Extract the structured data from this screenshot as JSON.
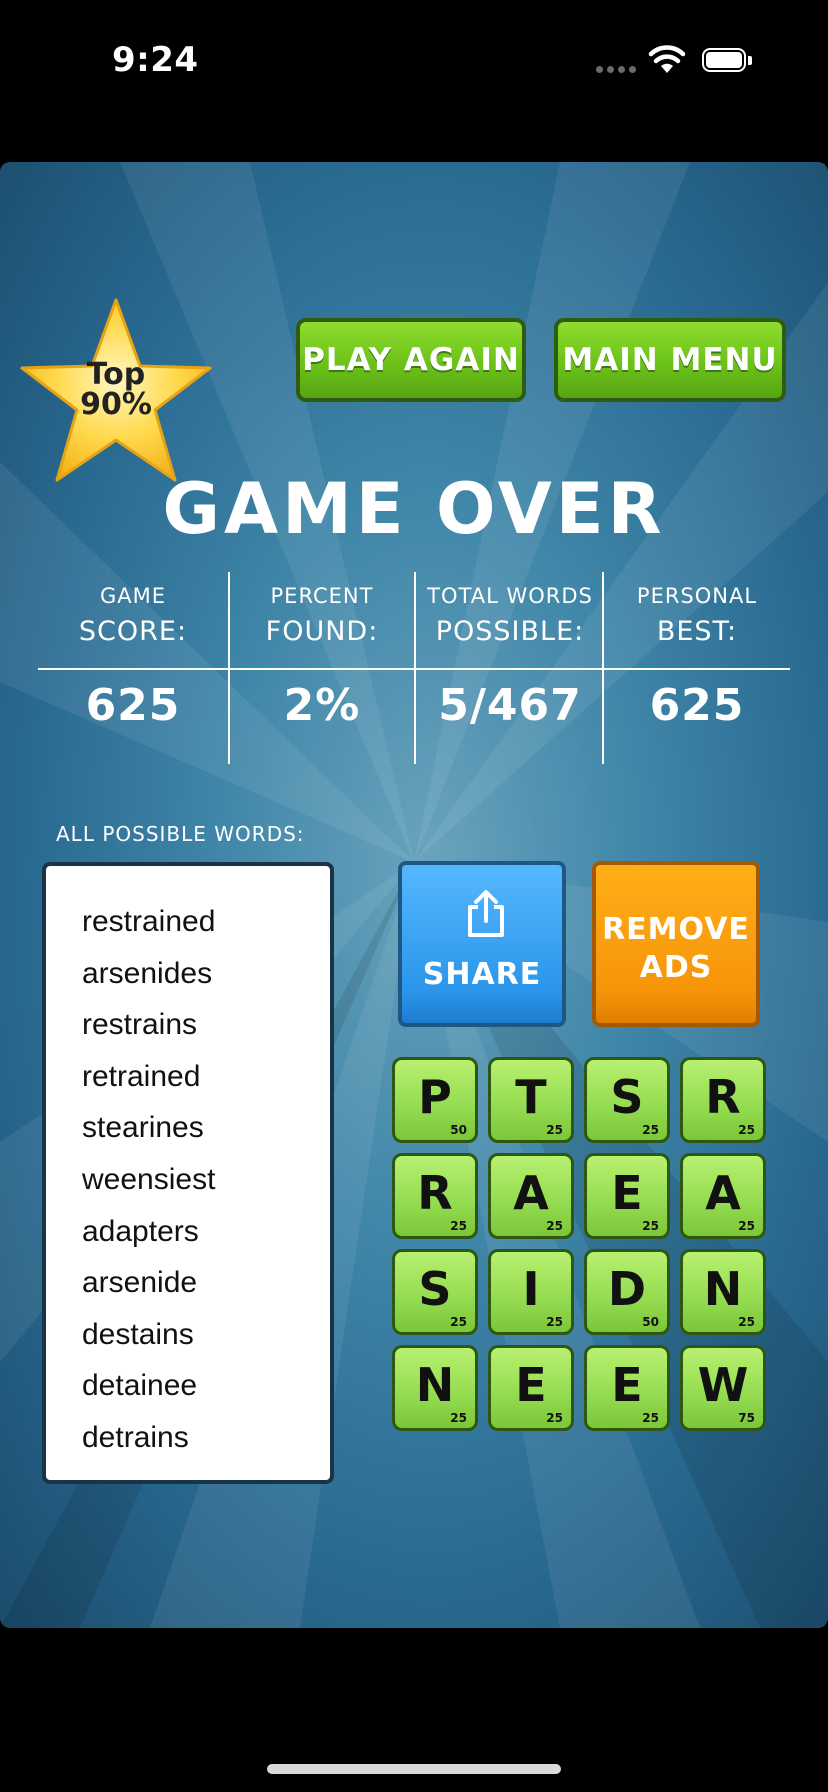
{
  "status_bar": {
    "time": "9:24"
  },
  "badge": {
    "line1": "Top",
    "line2": "90%"
  },
  "buttons": {
    "play_again": "PLAY AGAIN",
    "main_menu": "MAIN MENU",
    "share": "SHARE",
    "remove_ads_line1": "REMOVE",
    "remove_ads_line2": "ADS"
  },
  "title": "GAME OVER",
  "stats": [
    {
      "label1": "GAME",
      "label2": "SCORE:",
      "value": "625"
    },
    {
      "label1": "PERCENT",
      "label2": "FOUND:",
      "value": "2%"
    },
    {
      "label1": "TOTAL WORDS",
      "label2": "POSSIBLE:",
      "value": "5/467"
    },
    {
      "label1": "PERSONAL",
      "label2": "BEST:",
      "value": "625"
    }
  ],
  "words_label": "ALL POSSIBLE WORDS:",
  "words": [
    "restrained",
    "arsenides",
    "restrains",
    "retrained",
    "stearines",
    "weensiest",
    "adapters",
    "arsenide",
    "destains",
    "detainee",
    "detrains"
  ],
  "board": [
    [
      {
        "letter": "P",
        "points": "50"
      },
      {
        "letter": "T",
        "points": "25"
      },
      {
        "letter": "S",
        "points": "25"
      },
      {
        "letter": "R",
        "points": "25"
      }
    ],
    [
      {
        "letter": "R",
        "points": "25"
      },
      {
        "letter": "A",
        "points": "25"
      },
      {
        "letter": "E",
        "points": "25"
      },
      {
        "letter": "A",
        "points": "25"
      }
    ],
    [
      {
        "letter": "S",
        "points": "25"
      },
      {
        "letter": "I",
        "points": "25"
      },
      {
        "letter": "D",
        "points": "50"
      },
      {
        "letter": "N",
        "points": "25"
      }
    ],
    [
      {
        "letter": "N",
        "points": "25"
      },
      {
        "letter": "E",
        "points": "25"
      },
      {
        "letter": "E",
        "points": "25"
      },
      {
        "letter": "W",
        "points": "75"
      }
    ]
  ],
  "colors": {
    "button_green": "#6cc21a",
    "share_blue": "#2a95ea",
    "remove_ads_orange": "#f69408",
    "tile_green": "#96dd52",
    "background_blue": "#2a6b92"
  },
  "icons": {
    "share": "share-icon",
    "star": "star-icon",
    "wifi": "wifi-icon",
    "battery": "battery-icon"
  }
}
